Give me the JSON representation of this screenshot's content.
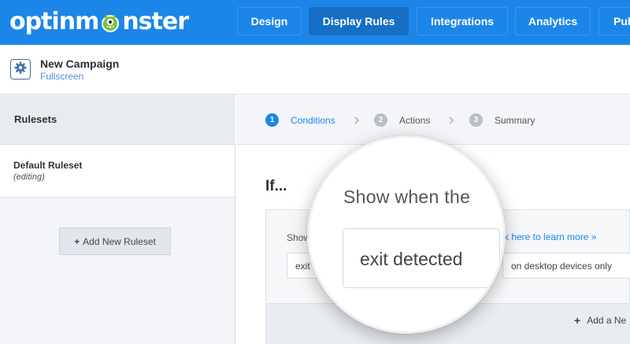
{
  "brand": {
    "logo_before": "optinm",
    "logo_after": "nster",
    "accent": "#1c86e8"
  },
  "nav": {
    "tabs": [
      {
        "label": "Design",
        "active": false
      },
      {
        "label": "Display Rules",
        "active": true
      },
      {
        "label": "Integrations",
        "active": false
      },
      {
        "label": "Analytics",
        "active": false
      },
      {
        "label": "Pub",
        "active": false
      }
    ]
  },
  "campaign": {
    "icon": "gear-icon",
    "name": "New Campaign",
    "type": "Fullscreen"
  },
  "sidebar": {
    "title": "Rulesets",
    "rulesets": [
      {
        "name": "Default Ruleset",
        "status": "(editing)"
      }
    ],
    "add_button": "Add New Ruleset"
  },
  "steps": [
    {
      "number": "1",
      "label": "Conditions",
      "current": true
    },
    {
      "number": "2",
      "label": "Actions",
      "current": false
    },
    {
      "number": "3",
      "label": "Summary",
      "current": false
    }
  ],
  "main": {
    "heading": "If...",
    "condition": {
      "show_label_partial": "Show",
      "select_value_partial": "exit",
      "learn_more_partial": "k here to learn more »",
      "device_value": "on desktop devices only"
    },
    "add_condition_partial": "Add a Ne"
  },
  "magnifier": {
    "heading": "Show when the",
    "select_value": "exit detected"
  }
}
